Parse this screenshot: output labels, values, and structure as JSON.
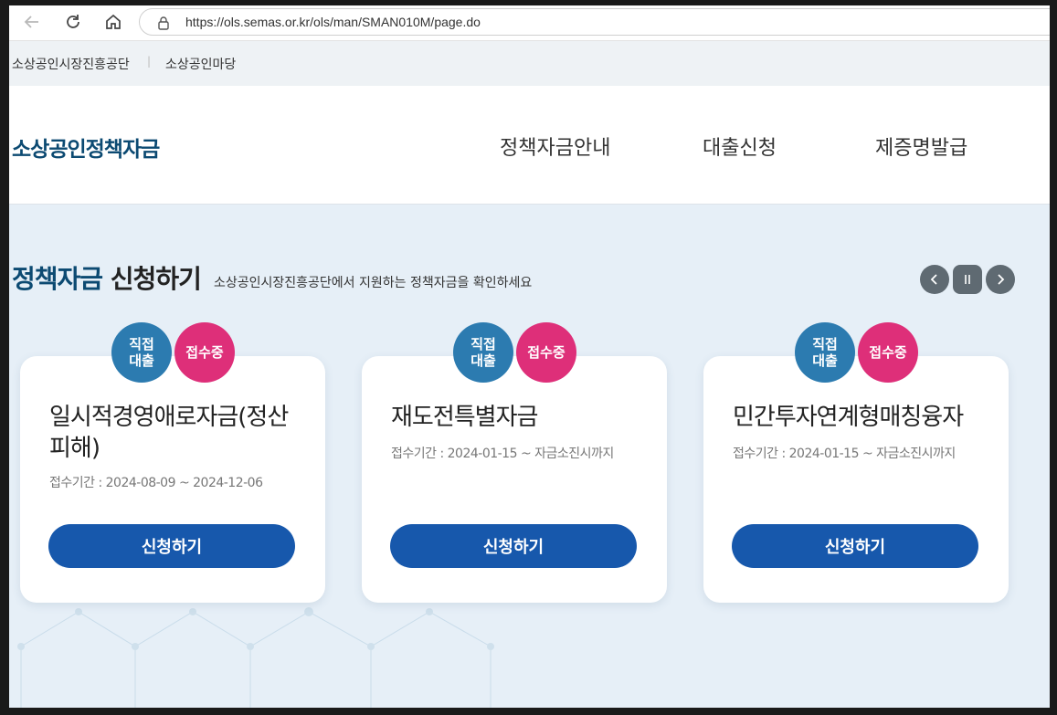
{
  "browser": {
    "url": "https://ols.semas.or.kr/ols/man/SMAN010M/page.do"
  },
  "util_nav": {
    "items": [
      "소상공인시장진흥공단",
      "소상공인마당"
    ],
    "separator": "|"
  },
  "header": {
    "logo": "소상공인정책자금",
    "menu": [
      "정책자금안내",
      "대출신청",
      "제증명발급"
    ]
  },
  "section": {
    "title_highlight": "정책자금",
    "title_rest": "신청하기",
    "subtitle": "소상공인시장진흥공단에서 지원하는 정책자금을 확인하세요"
  },
  "cards": [
    {
      "badge_type": "직접\n대출",
      "badge_status": "접수중",
      "title": "일시적경영애로자금(정산피해)",
      "period": "접수기간 : 2024-08-09 ~ 2024-12-06",
      "button": "신청하기"
    },
    {
      "badge_type": "직접\n대출",
      "badge_status": "접수중",
      "title": "재도전특별자금",
      "period": "접수기간 : 2024-01-15 ~ 자금소진시까지",
      "button": "신청하기"
    },
    {
      "badge_type": "직접\n대출",
      "badge_status": "접수중",
      "title": "민간투자연계형매칭융자",
      "period": "접수기간 : 2024-01-15 ~ 자금소진시까지",
      "button": "신청하기"
    }
  ],
  "colors": {
    "brand_navy": "#0c4a72",
    "button_blue": "#1758ac",
    "badge_blue": "#2c7bb0",
    "badge_pink": "#de2f79",
    "background": "#e6eff7"
  },
  "icons": [
    "back-arrow-icon",
    "reload-icon",
    "home-icon",
    "lock-icon",
    "prev-icon",
    "pause-icon",
    "next-icon"
  ]
}
